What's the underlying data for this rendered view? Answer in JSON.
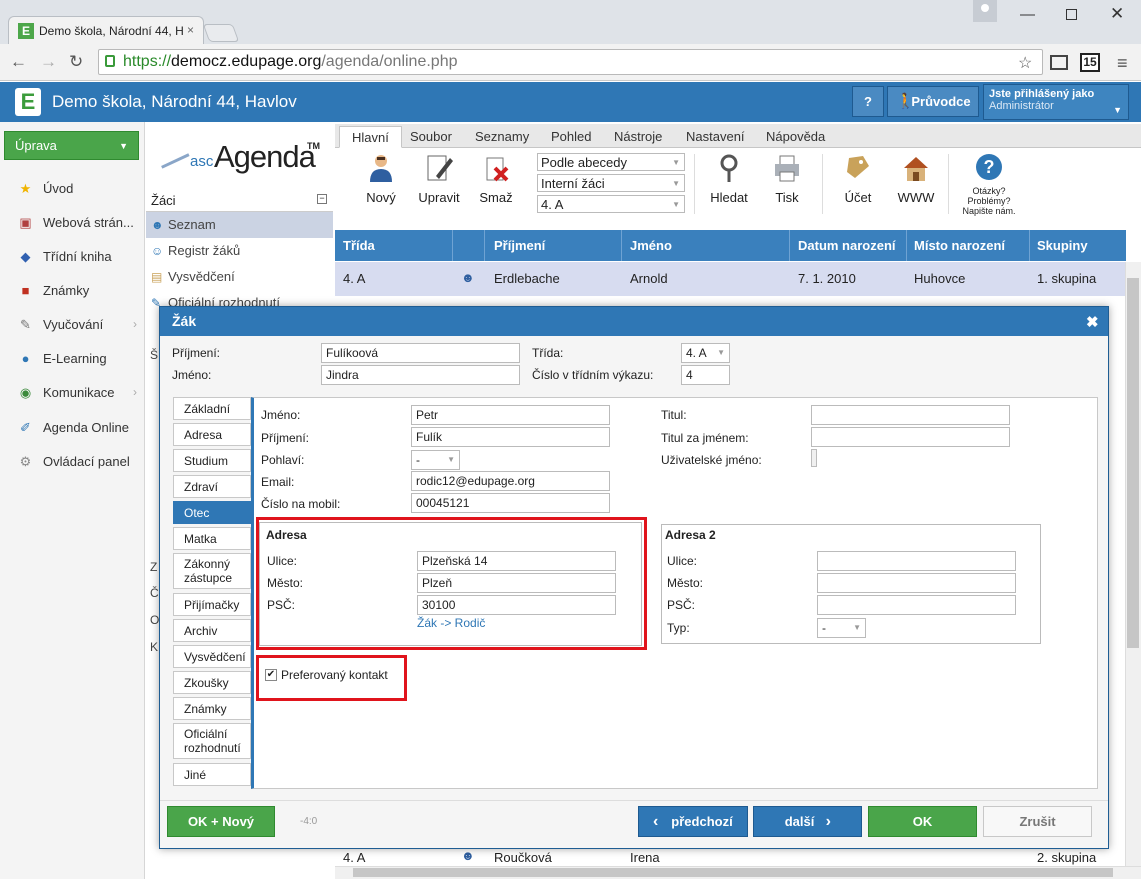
{
  "browser": {
    "tab_title": "Demo škola, Národní 44, H",
    "tab_close": "×",
    "url_scheme": "https://",
    "url_host": "democz.edupage.org",
    "url_path": "/agenda/online.php",
    "ext_badge": "15"
  },
  "app": {
    "logo": "E",
    "school_name": "Demo škola, Národní 44, Havlov",
    "help_label": "?",
    "guide_label": "Průvodce",
    "user_line1": "Jste přihlášený jako",
    "user_line2": "Administrátor"
  },
  "sidebar": {
    "uprava": "Úprava",
    "items": [
      {
        "label": "Úvod",
        "icon": "star-icon"
      },
      {
        "label": "Webová strán...",
        "icon": "web-icon"
      },
      {
        "label": "Třídní kniha",
        "icon": "book-icon"
      },
      {
        "label": "Známky",
        "icon": "grades-icon"
      },
      {
        "label": "Vyučování",
        "icon": "teaching-icon"
      },
      {
        "label": "E-Learning",
        "icon": "elearning-icon"
      },
      {
        "label": "Komunikace",
        "icon": "communication-icon"
      },
      {
        "label": "Agenda Online",
        "icon": "agenda-icon"
      },
      {
        "label": "Ovládací panel",
        "icon": "control-panel-icon"
      }
    ]
  },
  "agenda": {
    "logo_asc": "asc",
    "logo_agenda": "Agenda",
    "logo_tm": "TM",
    "section": "Žáci",
    "minimize": "−",
    "tree": [
      "Seznam",
      "Registr žáků",
      "Vysvědčení",
      "Oficiální rozhodnutí"
    ],
    "tree_stubs": [
      "Š",
      "Z",
      "Č",
      "O",
      "K"
    ]
  },
  "ribbon": {
    "tabs": [
      "Hlavní",
      "Soubor",
      "Seznamy",
      "Pohled",
      "Nástroje",
      "Nastavení",
      "Nápověda"
    ],
    "buttons": {
      "new": "Nový",
      "edit": "Upravit",
      "delete": "Smaž",
      "search": "Hledat",
      "print": "Tisk",
      "account": "Účet",
      "www": "WWW",
      "help": "Otázky? Problémy? Napište nám."
    },
    "selects": [
      "Podle abecedy",
      "Interní žáci",
      "4. A"
    ]
  },
  "table": {
    "headers": [
      "Třída",
      "",
      "Příjmení",
      "Jméno",
      "Datum narození",
      "Místo narození",
      "Skupiny"
    ],
    "row1": [
      "4. A",
      "",
      "Erdlebache",
      "Arnold",
      "7. 1. 2010",
      "Huhovce",
      "1. skupina"
    ],
    "rowlast": [
      "4. A",
      "",
      "Roučková",
      "Irena",
      "",
      "",
      "2. skupina"
    ]
  },
  "dialog": {
    "title": "Žák",
    "close": "✖",
    "prijmeni_label": "Příjmení:",
    "prijmeni_value": "Fulíkoová",
    "jmeno_label": "Jméno:",
    "jmeno_value": "Jindra",
    "trida_label": "Třída:",
    "trida_value": "4. A",
    "cislo_label": "Číslo v třídním výkazu:",
    "cislo_value": "4",
    "tabs": [
      "Základní",
      "Adresa",
      "Studium",
      "Zdraví",
      "Otec",
      "Matka",
      "Zákonný zástupce",
      "Přijímačky",
      "Archiv",
      "Vysvědčení",
      "Zkoušky",
      "Známky",
      "Oficiální rozhodnutí",
      "Jiné"
    ],
    "active_tab": "Otec",
    "form": {
      "jmeno_l": "Jméno:",
      "jmeno_v": "Petr",
      "prijmeni_l": "Příjmení:",
      "prijmeni_v": "Fulík",
      "pohlavi_l": "Pohlaví:",
      "pohlavi_v": "-",
      "email_l": "Email:",
      "email_v": "rodic12@edupage.org",
      "mobil_l": "Číslo na mobil:",
      "mobil_v": "00045121",
      "titul_l": "Titul:",
      "titul_v": "",
      "titulza_l": "Titul za jménem:",
      "titulza_v": "",
      "user_l": "Uživatelské jméno:"
    },
    "adresa": {
      "title": "Adresa",
      "ulice_l": "Ulice:",
      "ulice_v": "Plzeňská 14",
      "mesto_l": "Město:",
      "mesto_v": "Plzeň",
      "psc_l": "PSČ:",
      "psc_v": "30100",
      "link": "Žák -> Rodič"
    },
    "adresa2": {
      "title": "Adresa 2",
      "ulice_l": "Ulice:",
      "mesto_l": "Město:",
      "psc_l": "PSČ:",
      "typ_l": "Typ:",
      "typ_v": "-"
    },
    "preferovany": "Preferovaný kontakt",
    "footer": {
      "ok_new": "OK + Nový",
      "counter": "-4:0",
      "prev": "předchozí",
      "next": "další",
      "ok": "OK",
      "cancel": "Zrušit"
    }
  }
}
